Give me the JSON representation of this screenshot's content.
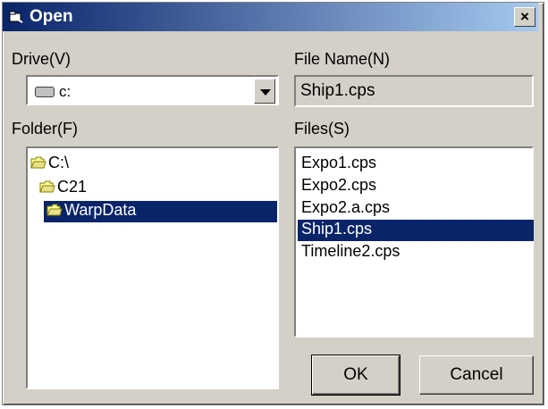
{
  "window": {
    "title": "Open",
    "close_glyph": "×",
    "title_icon": "open-dialog-icon"
  },
  "drive": {
    "label": "Drive(V)",
    "value": "c:",
    "icon": "drive-icon"
  },
  "file_name": {
    "label": "File Name(N)",
    "value": "Ship1.cps"
  },
  "folder": {
    "label": "Folder(F)",
    "items": [
      {
        "name": "C:\\",
        "selected": false,
        "icon": "open-folder-icon"
      },
      {
        "name": "C21",
        "selected": false,
        "icon": "open-folder-icon"
      },
      {
        "name": "WarpData",
        "selected": true,
        "icon": "open-folder-icon"
      }
    ]
  },
  "files": {
    "label": "Files(S)",
    "items": [
      {
        "name": "Expo1.cps",
        "selected": false
      },
      {
        "name": "Expo2.cps",
        "selected": false
      },
      {
        "name": "Expo2.a.cps",
        "selected": false
      },
      {
        "name": "Ship1.cps",
        "selected": true
      },
      {
        "name": "Timeline2.cps",
        "selected": false
      }
    ]
  },
  "buttons": {
    "ok": "OK",
    "cancel": "Cancel"
  },
  "colors": {
    "face": "#d4d0c8",
    "selection": "#0a246a",
    "title_start": "#0a246a",
    "title_end": "#a6caf0"
  }
}
